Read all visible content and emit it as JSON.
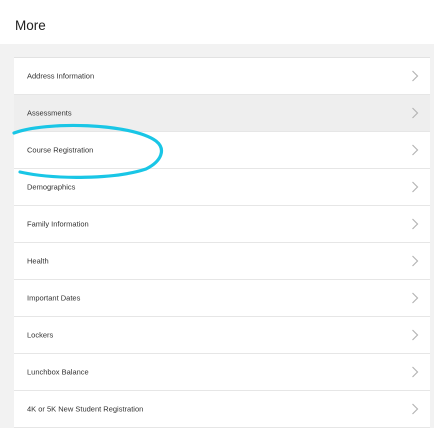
{
  "header": {
    "title": "More"
  },
  "menu": {
    "items": [
      {
        "label": "Address Information"
      },
      {
        "label": "Assessments"
      },
      {
        "label": "Course Registration"
      },
      {
        "label": "Demographics"
      },
      {
        "label": "Family Information"
      },
      {
        "label": "Health"
      },
      {
        "label": "Important Dates"
      },
      {
        "label": "Lockers"
      },
      {
        "label": "Lunchbox Balance"
      },
      {
        "label": "4K or 5K New Student Registration"
      }
    ],
    "chevron_icon": "chevron-right-icon"
  },
  "colors": {
    "annotation_stroke": "#19c6e6",
    "selected_row": "#eeeeee",
    "chevron": "#b5b5b5"
  }
}
